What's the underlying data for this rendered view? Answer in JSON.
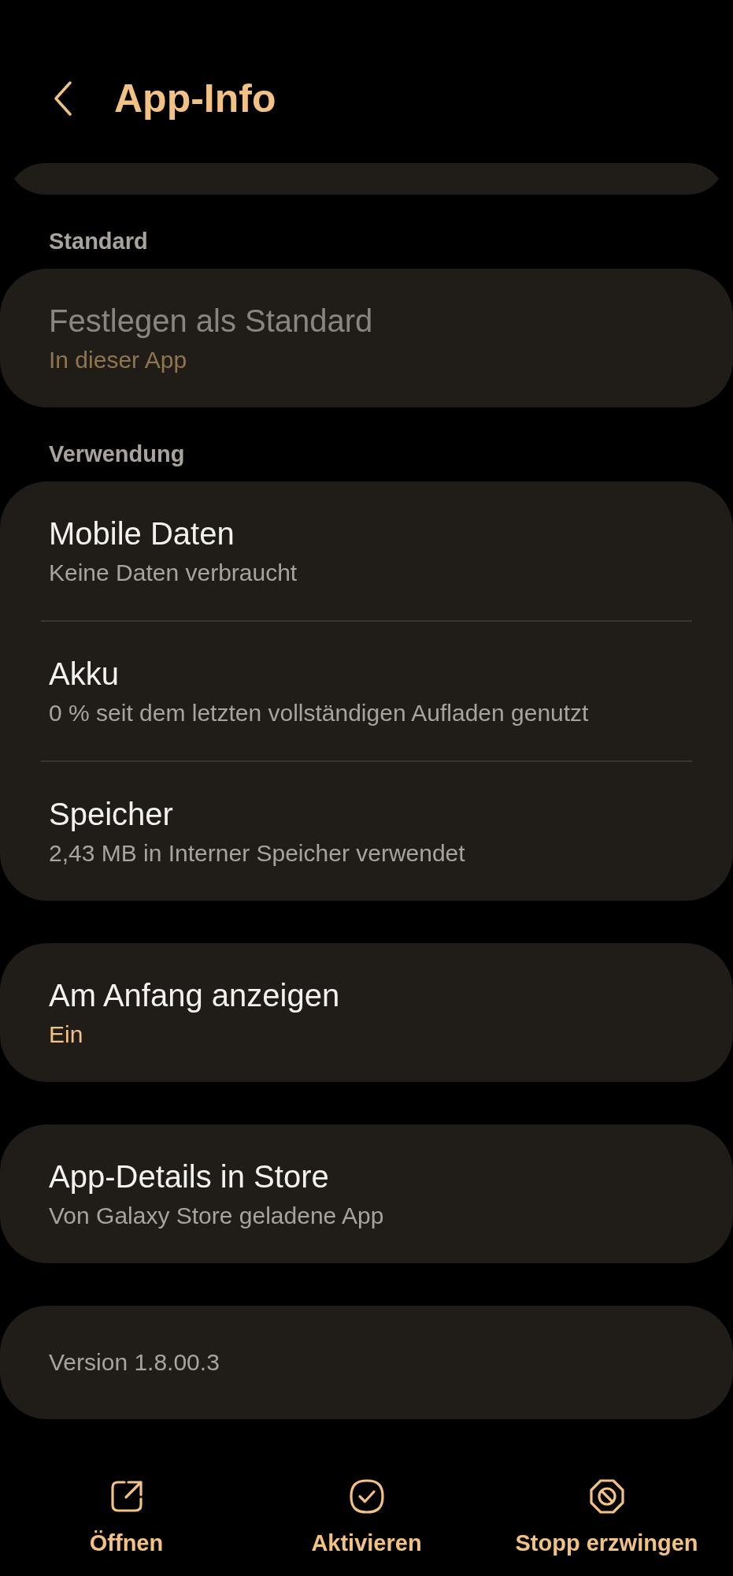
{
  "header": {
    "title": "App-Info"
  },
  "sections": [
    {
      "heading": "Standard",
      "items": [
        {
          "title": "Festlegen als Standard",
          "subtitle": "In dieser App",
          "kind": "summary",
          "disabled": true
        }
      ]
    },
    {
      "heading": "Verwendung",
      "items": [
        {
          "title": "Mobile Daten",
          "subtitle": "Keine Daten verbraucht",
          "kind": "summary",
          "disabled": false
        },
        {
          "title": "Akku",
          "subtitle": "0 % seit dem letzten vollständigen Aufladen genutzt",
          "kind": "summary",
          "disabled": false
        },
        {
          "title": "Speicher",
          "subtitle": "2,43 MB in Interner Speicher verwendet",
          "kind": "summary",
          "disabled": false
        }
      ]
    },
    {
      "items": [
        {
          "title": "Am Anfang anzeigen",
          "subtitle": "Ein",
          "kind": "value",
          "disabled": false
        }
      ]
    },
    {
      "items": [
        {
          "title": "App-Details in Store",
          "subtitle": "Von Galaxy Store geladene App",
          "kind": "summary",
          "disabled": false
        }
      ]
    }
  ],
  "version": "Version 1.8.00.3",
  "actions": [
    {
      "label": "Öffnen",
      "kind": "open"
    },
    {
      "label": "Aktivieren",
      "kind": "enable"
    },
    {
      "label": "Stopp erzwingen",
      "kind": "stop"
    }
  ]
}
